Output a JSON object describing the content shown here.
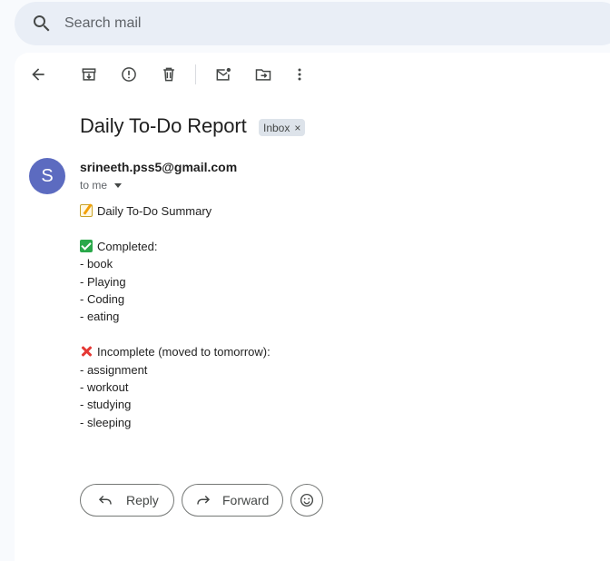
{
  "search": {
    "placeholder": "Search mail",
    "icon": "search-icon"
  },
  "toolbar": {
    "back": "back-arrow-icon",
    "archive": "archive-icon",
    "report_spam": "report-spam-icon",
    "delete": "delete-icon",
    "mark_unread": "mark-unread-icon",
    "move_to": "move-to-icon",
    "more": "more-vert-icon"
  },
  "email": {
    "subject": "Daily To-Do Report",
    "label": "Inbox",
    "label_close": "×",
    "avatar_letter": "S",
    "avatar_color": "#5c6bc0",
    "sender": "srineeth.pss5@gmail.com",
    "recipient": "to me",
    "body": {
      "summary_heading": "Daily To-Do Summary",
      "completed_heading": "Completed:",
      "completed_items": [
        "- book",
        "- Playing",
        "- Coding",
        "- eating"
      ],
      "incomplete_heading": "Incomplete (moved to tomorrow):",
      "incomplete_items": [
        "- assignment",
        "- workout",
        "- studying",
        "- sleeping"
      ]
    }
  },
  "actions": {
    "reply_label": "Reply",
    "forward_label": "Forward"
  }
}
